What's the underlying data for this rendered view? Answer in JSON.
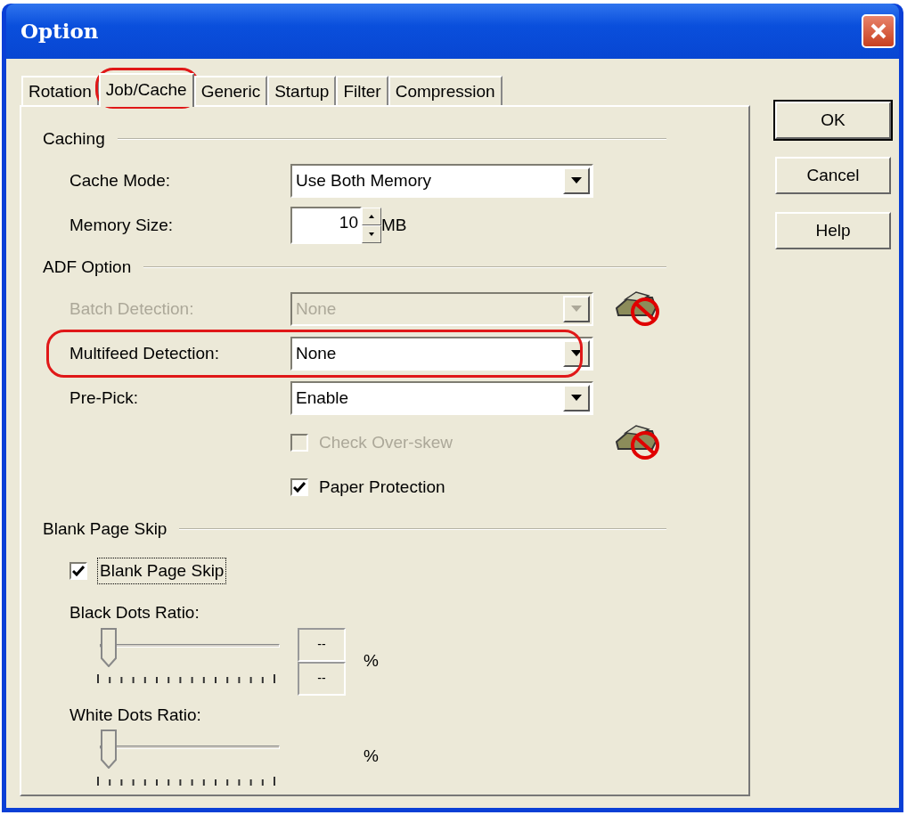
{
  "window": {
    "title": "Option"
  },
  "tabs": [
    {
      "label": "Rotation",
      "selected": false,
      "highlighted": false
    },
    {
      "label": "Job/Cache",
      "selected": true,
      "highlighted": true
    },
    {
      "label": "Generic",
      "selected": false,
      "highlighted": false
    },
    {
      "label": "Startup",
      "selected": false,
      "highlighted": false
    },
    {
      "label": "Filter",
      "selected": false,
      "highlighted": false
    },
    {
      "label": "Compression",
      "selected": false,
      "highlighted": false
    }
  ],
  "sections": [
    {
      "title": "Caching",
      "rows": [
        {
          "kind": "dropdown",
          "label": "Cache Mode:",
          "value": "Use Both Memory",
          "disabled": false,
          "highlighted": false,
          "unavailable_icon": false
        },
        {
          "kind": "spinner",
          "label": "Memory Size:",
          "value": "10",
          "unit": "MB",
          "disabled": false,
          "highlighted": false,
          "unavailable_icon": false
        }
      ]
    },
    {
      "title": "ADF Option",
      "rows": [
        {
          "kind": "dropdown",
          "label": "Batch Detection:",
          "value": "None",
          "disabled": true,
          "highlighted": false,
          "unavailable_icon": true
        },
        {
          "kind": "dropdown",
          "label": "Multifeed Detection:",
          "value": "None",
          "disabled": false,
          "highlighted": true,
          "unavailable_icon": false
        },
        {
          "kind": "dropdown",
          "label": "Pre-Pick:",
          "value": "Enable",
          "disabled": false,
          "highlighted": false,
          "unavailable_icon": false
        },
        {
          "kind": "checkbox",
          "label": "Check Over-skew",
          "checked": false,
          "focused": false,
          "disabled": true,
          "highlighted": false,
          "unavailable_icon": true
        },
        {
          "kind": "checkbox",
          "label": "Paper Protection",
          "checked": true,
          "focused": false,
          "disabled": false,
          "highlighted": false,
          "unavailable_icon": false
        }
      ]
    },
    {
      "title": "Blank Page Skip",
      "rows": [
        {
          "kind": "checkbox",
          "label": "Blank Page Skip",
          "checked": true,
          "focused": true,
          "disabled": false,
          "highlighted": false,
          "unavailable_icon": false
        },
        {
          "kind": "slider",
          "label": "Black Dots Ratio:",
          "level": 0,
          "readings": [
            "--",
            "--"
          ],
          "unit": "%",
          "disabled": false,
          "highlighted": false,
          "unavailable_icon": false
        },
        {
          "kind": "slider",
          "label": "White Dots Ratio:",
          "level": 0,
          "readings": [],
          "unit": "%",
          "disabled": false,
          "highlighted": false,
          "unavailable_icon": false
        }
      ]
    }
  ],
  "buttons": [
    {
      "label": "OK",
      "default": true
    },
    {
      "label": "Cancel",
      "default": false
    },
    {
      "label": "Help",
      "default": false
    }
  ]
}
